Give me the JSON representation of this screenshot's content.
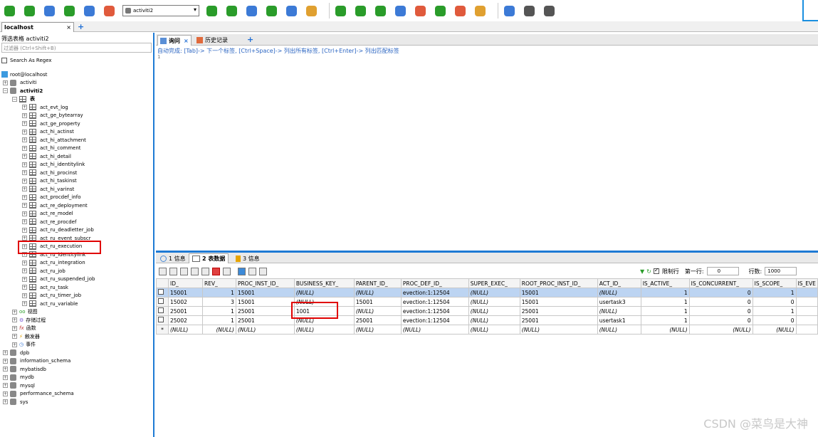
{
  "toolbar": {
    "db_selected": "activiti2",
    "icons": [
      "connect-icon",
      "new-query-icon",
      "play-icon",
      "fast-forward-icon",
      "schedule-icon",
      "user-icon",
      "database-add-icon",
      "database-copy-icon",
      "database-icon",
      "table-icon",
      "grid-icon",
      "form-icon",
      "check-icon",
      "refresh-icon",
      "sync-icon",
      "backup-icon",
      "clock-icon",
      "restore-icon",
      "window-icon",
      "compare-icon",
      "db-stack-icon",
      "db-arrow-icon",
      "db-export-icon"
    ]
  },
  "conn_tab": {
    "label": "localhost",
    "close": "×"
  },
  "left": {
    "filter_title": "筛选表格 activiti2",
    "filter_placeholder": "过滤器 (Ctrl+Shift+B)",
    "regex_label": "Search As Regex",
    "root": "root@localhost",
    "databases_top": [
      "activiti",
      "activiti2"
    ],
    "tables_group": "表",
    "tables": [
      "act_evt_log",
      "act_ge_bytearray",
      "act_ge_property",
      "act_hi_actinst",
      "act_hi_attachment",
      "act_hi_comment",
      "act_hi_detail",
      "act_hi_identitylink",
      "act_hi_procinst",
      "act_hi_taskinst",
      "act_hi_varinst",
      "act_procdef_info",
      "act_re_deployment",
      "act_re_model",
      "act_re_procdef",
      "act_ru_deadletter_job",
      "act_ru_event_subscr",
      "act_ru_execution",
      "act_ru_identitylink",
      "act_ru_integration",
      "act_ru_job",
      "act_ru_suspended_job",
      "act_ru_task",
      "act_ru_timer_job",
      "act_ru_variable"
    ],
    "groups": [
      "视图",
      "存储过程",
      "函数",
      "触发器",
      "事件"
    ],
    "databases_bottom": [
      "dpb",
      "information_schema",
      "mybatisdb",
      "mydb",
      "mysql",
      "performance_schema",
      "sys"
    ]
  },
  "query_tabs": [
    {
      "label": "询问",
      "close": "×"
    },
    {
      "label": "历史记录"
    }
  ],
  "hint": "自动完成: [Tab]-> 下一个标签, [Ctrl+Space]-> 列出所有标签, [Ctrl+Enter]-> 列出匹配标签",
  "line_no": "1",
  "result_tabs": [
    {
      "num": "1",
      "label": "信息"
    },
    {
      "num": "2",
      "label": "表数据"
    },
    {
      "num": "3",
      "label": "信息"
    }
  ],
  "grid": {
    "limit_label": "限制行",
    "first_row_label": "第一行:",
    "first_row": "0",
    "rows_label": "行数:",
    "rows": "1000",
    "columns": [
      "ID_",
      "REV_",
      "PROC_INST_ID_",
      "BUSINESS_KEY_",
      "PARENT_ID_",
      "PROC_DEF_ID_",
      "SUPER_EXEC_",
      "ROOT_PROC_INST_ID_",
      "ACT_ID_",
      "IS_ACTIVE_",
      "IS_CONCURRENT_",
      "IS_SCOPE_",
      "IS_EVE"
    ],
    "rows_data": [
      [
        "15001",
        "1",
        "15001",
        "(NULL)",
        "(NULL)",
        "evection:1:12504",
        "(NULL)",
        "15001",
        "(NULL)",
        "1",
        "0",
        "1",
        ""
      ],
      [
        "15002",
        "3",
        "15001",
        "(NULL)",
        "15001",
        "evection:1:12504",
        "(NULL)",
        "15001",
        "usertask3",
        "1",
        "0",
        "0",
        ""
      ],
      [
        "25001",
        "1",
        "25001",
        "1001",
        "(NULL)",
        "evection:1:12504",
        "(NULL)",
        "25001",
        "(NULL)",
        "1",
        "0",
        "1",
        ""
      ],
      [
        "25002",
        "1",
        "25001",
        "(NULL)",
        "25001",
        "evection:1:12504",
        "(NULL)",
        "25001",
        "usertask1",
        "1",
        "0",
        "0",
        ""
      ],
      [
        "(NULL)",
        "(NULL)",
        "(NULL)",
        "(NULL)",
        "(NULL)",
        "(NULL)",
        "(NULL)",
        "(NULL)",
        "(NULL)",
        "(NULL)",
        "(NULL)",
        "(NULL)",
        ""
      ]
    ],
    "new_row_marker": "*"
  },
  "watermark": "CSDN @菜鸟是大神"
}
